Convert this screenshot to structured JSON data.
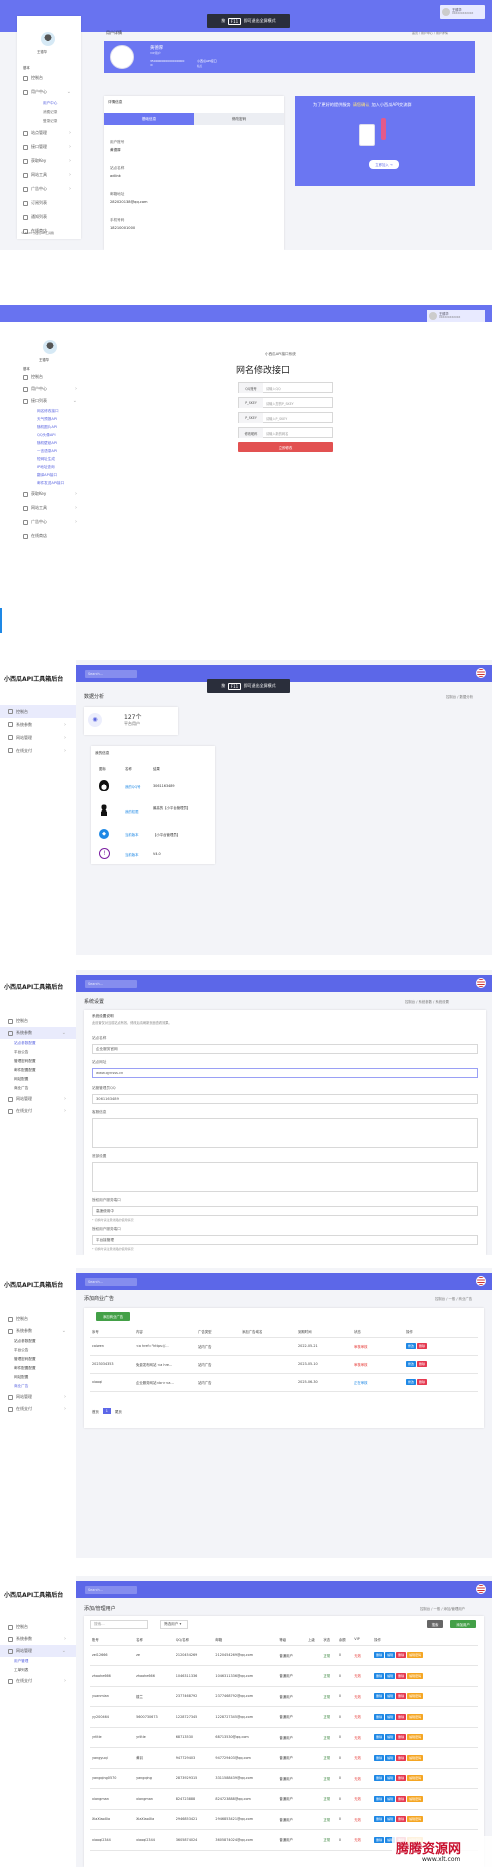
{
  "overlay_tag": {
    "key": "F11",
    "left": "按",
    "right": "即可退出全屏模式"
  },
  "panel1": {
    "user_chip": {
      "name": "王德华",
      "sub": "XXXXXXXXXXXX"
    },
    "sidebar": {
      "username": "王德华",
      "section": "基本",
      "items": [
        "控制台",
        "用户中心",
        "站点管理",
        "接口管理",
        "获取Key",
        "网站工具",
        "广告中心",
        "订阅列表",
        "通知列表",
        "在线商店"
      ],
      "subitems": [
        "用户中心",
        "消费记录",
        "登录记录"
      ],
      "footer": "© 2023 小西瓜API工具箱"
    },
    "page_title": "用户详情",
    "breadcrumb": "首页 / 用户中心 / 用户详情",
    "profile": {
      "name": "黄德厚",
      "role": "VIP用户",
      "id": "350000000000000000",
      "id_label": "ID",
      "site": "小西瓜API接口",
      "site_label": "站点"
    },
    "detail_header": "详情信息",
    "tabs": [
      "基础信息",
      "修改密码"
    ],
    "fields": [
      {
        "label": "用户账号",
        "value": "黄德厚"
      },
      {
        "label": "站点名称",
        "value": "adlink"
      },
      {
        "label": "邮箱地址",
        "value": "282020138@qq.com"
      },
      {
        "label": "手机号码",
        "value": "18210001000"
      }
    ],
    "promo": {
      "title": "为了更好的提供服务",
      "highlight": "请您确认",
      "title_end": "加入小西瓜API交流群",
      "button": "立即加入 →"
    }
  },
  "panel2": {
    "user_chip": {
      "name": "王德华",
      "sub": "XXXXXXXXXXXX"
    },
    "sidebar": {
      "username": "王德华",
      "section": "基本",
      "items": [
        "控制台",
        "用户中心",
        "接口列表",
        "获取Key",
        "网站工具",
        "广告中心",
        "在线商店"
      ],
      "subitems": [
        "网名修改接口",
        "天气预报API",
        "随机图片API",
        "QQ头像API",
        "随机壁纸API",
        "一言语录API",
        "短网址生成",
        "IP地址查询",
        "翻译API接口",
        "邮件发送API接口"
      ]
    },
    "form": {
      "subtitle": "小西瓜API接口系统",
      "title": "网名修改接口",
      "rows": [
        {
          "label": "QQ账号",
          "placeholder": "请输入QQ"
        },
        {
          "label": "P_SKEY",
          "placeholder": "请输入您的P_SKEY"
        },
        {
          "label": "P_SKEY",
          "placeholder": "请输入P_SKEY"
        },
        {
          "label": "修改昵称",
          "placeholder": "请输入新的网名"
        }
      ],
      "submit": "立即修改"
    }
  },
  "admin": {
    "logo": "小西瓜API工具箱后台",
    "search_placeholder": "Search...",
    "menu": [
      "控制台",
      "系统参数",
      "网站管理",
      "在线支付"
    ],
    "settings_submenu": [
      "站点参数配置",
      "平台公告",
      "管理密码配置",
      "邮件配置配置",
      "网站配置",
      "商业广告"
    ],
    "user_submenu": [
      "用户管理",
      "工单列表"
    ]
  },
  "panel3": {
    "title": "数据分析",
    "breadcrumb": "控制台 / 数据分析",
    "stat": {
      "count": "127个",
      "label": "平台用户"
    },
    "info_header": "我的信息",
    "info_cols": [
      "图标",
      "名称",
      "结果"
    ],
    "info_rows": [
      {
        "name": "我的QQ号",
        "value": "3061163489",
        "color": "#222"
      },
      {
        "name": "我的权限",
        "value": "最高的【小平台管理员】",
        "color": "#222"
      },
      {
        "name": "当前版本",
        "value": "【小平台管理员】",
        "color": "#1e88e5"
      },
      {
        "name": "当前版本",
        "value": "V4.0",
        "color": "#7b1fa2"
      }
    ]
  },
  "panel4": {
    "title": "系统设置",
    "breadcrumb": "控制台 / 系统参数 / 系统设置",
    "notice_title": "系统设置说明",
    "notice_text": "此设置仅对当前站点有效，修改后请刷新页面查看效果。",
    "fields": [
      {
        "label": "站点名称",
        "value": "企业服务官网"
      },
      {
        "label": "站点网址",
        "value": "www.qynsss.cn"
      },
      {
        "label": "站管管理员QQ",
        "value": "3061163489"
      },
      {
        "label": "客服信息",
        "value": ""
      },
      {
        "label": "底部设置",
        "value": ""
      },
      {
        "label": "授权用户服务端口",
        "value": "高速使用中"
      },
      {
        "label": "授权用户服务端口",
        "value": "平台接管理"
      }
    ],
    "hint": "* 切换时请注意线路的使用情况"
  },
  "panel5": {
    "title": "添加商业广告",
    "breadcrumb": "控制台 / 一般 / 商业广告",
    "add_button": "添加商业广告",
    "columns": [
      "序号",
      "内容",
      "广告类型",
      "添加广告域名",
      "到期时间",
      "状态",
      "操作"
    ],
    "rows": [
      {
        "no": "caiwen",
        "content": "<a href=\"https://...",
        "type": "站内广告",
        "domain": "",
        "date": "2022-05-21",
        "status": "审核审核",
        "status_color": "#e53935"
      },
      {
        "no": "2023034353",
        "content": "免费发布网站 <a hre...",
        "type": "站内广告",
        "domain": "",
        "date": "2023-05-10",
        "status": "审核审核",
        "status_color": "#e53935"
      },
      {
        "no": "xiaoqi",
        "content": "企业服务网站<br><a...",
        "type": "站内广告",
        "domain": "",
        "date": "2025-06-30",
        "status": "正在审核",
        "status_color": "#1e88e5"
      }
    ],
    "edit": "修改",
    "del": "删除",
    "pagination": [
      "首页",
      "1",
      "尾页"
    ]
  },
  "panel6": {
    "title": "添加/管理用户",
    "breadcrumb": "控制台 / 一般 / 添加/管理用户",
    "filter_placeholder": "搜索...",
    "filter_select": "筛选用户 ▾",
    "search_button": "搜索",
    "add_button": "添加用户",
    "columns": [
      "账号",
      "名称",
      "QQ/名称",
      "邮箱",
      "等级",
      "上级",
      "状态",
      "余额",
      "VIP",
      "操作"
    ],
    "rows": [
      {
        "account": "zel12666",
        "name": "ze",
        "qq": "2120454269",
        "mail": "2120454269@qq.com",
        "level": "普通用户",
        "status": "正常",
        "balance": "0",
        "vip": "无效"
      },
      {
        "account": "zhaohe666",
        "name": "zhaohe666",
        "qq": "1046311336",
        "mail": "1046311336@qq.com",
        "level": "普通用户",
        "status": "正常",
        "balance": "0",
        "vip": "无效"
      },
      {
        "account": "yuanmian",
        "name": "楼兰",
        "qq": "2377468792",
        "mail": "2377468792@qq.com",
        "level": "普通用户",
        "status": "正常",
        "balance": "0",
        "vip": "无效"
      },
      {
        "account": "yy200464",
        "name": "5600730673",
        "qq": "1228727345",
        "mail": "1228727345@qq.com",
        "level": "普通用户",
        "status": "正常",
        "balance": "0",
        "vip": "无效"
      },
      {
        "account": "yrlitle",
        "name": "yrlitle",
        "qq": "68713530",
        "mail": "68713530@qq.com",
        "level": "普通用户",
        "status": "正常",
        "balance": "0",
        "vip": "无效"
      },
      {
        "account": "yangyuqi",
        "name": "黄羽",
        "qq": "947729403",
        "mail": "947729403@qq.com",
        "level": "普通用户",
        "status": "正常",
        "balance": "0",
        "vip": "无效"
      },
      {
        "account": "yangqing0570",
        "name": "yangqing",
        "qq": "2873929315",
        "mail": "3311588439@qq.com",
        "level": "普通用户",
        "status": "正常",
        "balance": "0",
        "vip": "无效"
      },
      {
        "account": "xiongman",
        "name": "xiongman",
        "qq": "824723888",
        "mail": "824723888@qq.com",
        "level": "普通用户",
        "status": "正常",
        "balance": "0",
        "vip": "无效"
      },
      {
        "account": "XiaXiaoXia",
        "name": "XiaXiaoXia",
        "qq": "2946853421",
        "mail": "2946853421@qq.com",
        "level": "普通用户",
        "status": "正常",
        "balance": "0",
        "vip": "无效"
      },
      {
        "account": "xiaoqi2344",
        "name": "xiaoqi2344",
        "qq": "3605874024",
        "mail": "3605874024@qq.com",
        "level": "普通用户",
        "status": "正常",
        "balance": "0",
        "vip": "无效"
      }
    ],
    "actions": [
      "删除",
      "编辑",
      "删除",
      "编辑密码"
    ]
  },
  "watermark": {
    "text": "腾腾资源网",
    "sub": "www.xlt.com"
  }
}
